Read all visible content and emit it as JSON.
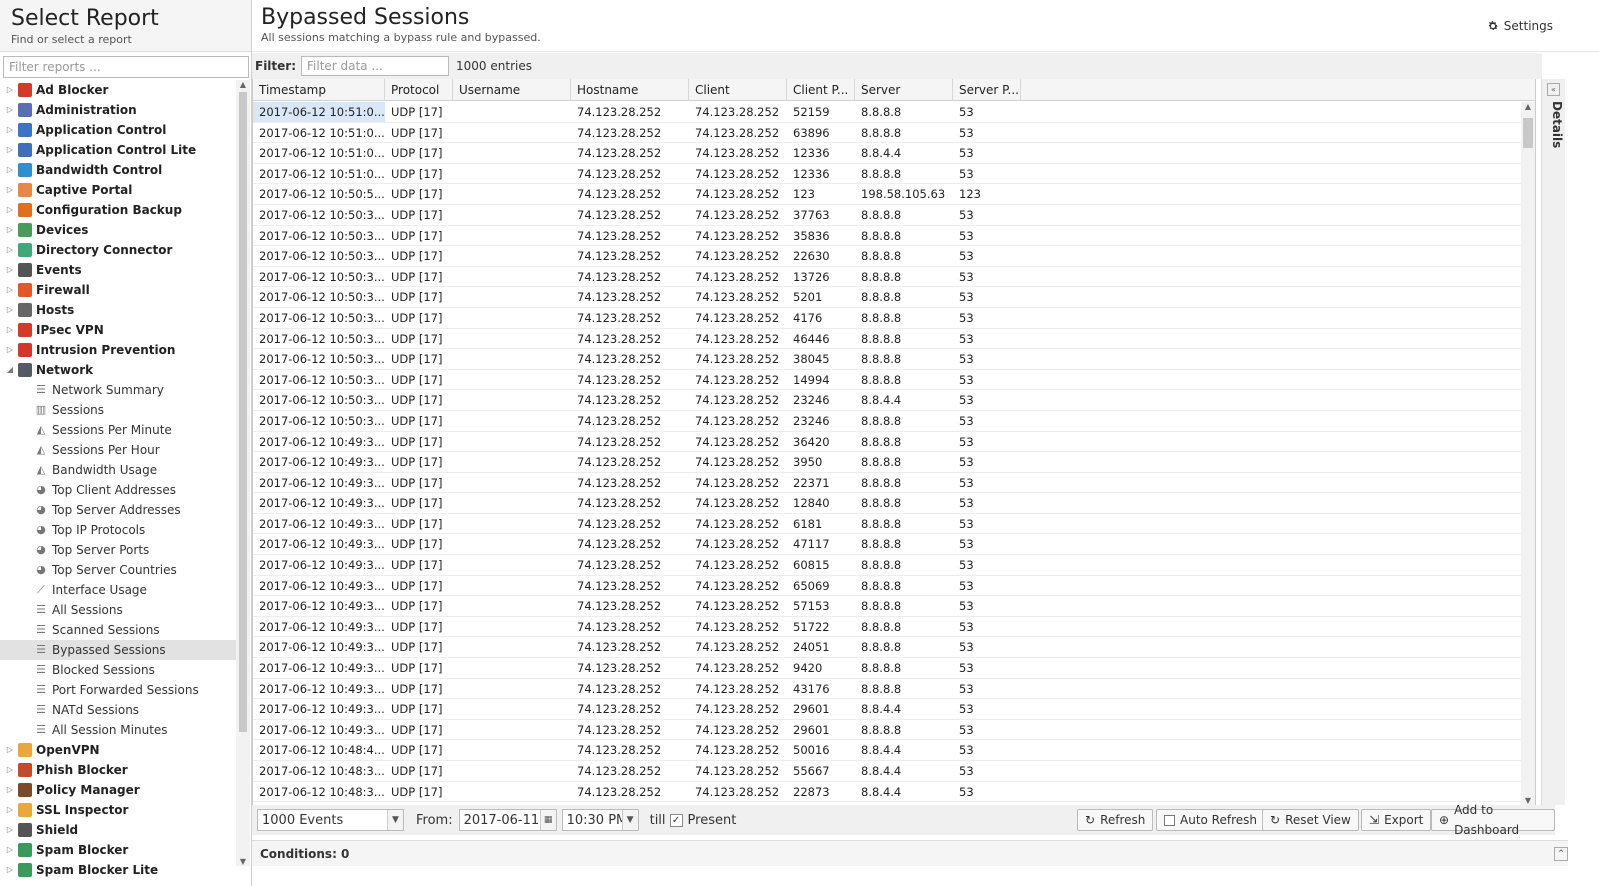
{
  "left_panel": {
    "title": "Select Report",
    "subtitle": "Find or select a report",
    "filter_placeholder": "Filter reports ..."
  },
  "tree": [
    {
      "label": "Ad Blocker",
      "type": "app",
      "icon": "ad-blocker-icon",
      "color": "#d23a2a",
      "expanded": false
    },
    {
      "label": "Administration",
      "type": "app",
      "icon": "administration-icon",
      "color": "#5a6fb3",
      "expanded": false
    },
    {
      "label": "Application Control",
      "type": "app",
      "icon": "application-control-icon",
      "color": "#3b73c6",
      "expanded": false
    },
    {
      "label": "Application Control Lite",
      "type": "app",
      "icon": "application-control-lite-icon",
      "color": "#3f6fb8",
      "expanded": false
    },
    {
      "label": "Bandwidth Control",
      "type": "app",
      "icon": "bandwidth-control-icon",
      "color": "#2f8fcf",
      "expanded": false
    },
    {
      "label": "Captive Portal",
      "type": "app",
      "icon": "captive-portal-icon",
      "color": "#e8874a",
      "expanded": false
    },
    {
      "label": "Configuration Backup",
      "type": "app",
      "icon": "configuration-backup-icon",
      "color": "#e0701f",
      "expanded": false
    },
    {
      "label": "Devices",
      "type": "app",
      "icon": "devices-icon",
      "color": "#4a9a5a",
      "expanded": false
    },
    {
      "label": "Directory Connector",
      "type": "app",
      "icon": "directory-connector-icon",
      "color": "#3eaa7a",
      "expanded": false
    },
    {
      "label": "Events",
      "type": "app",
      "icon": "events-icon",
      "color": "#555",
      "expanded": false
    },
    {
      "label": "Firewall",
      "type": "app",
      "icon": "firewall-icon",
      "color": "#e25a2a",
      "expanded": false
    },
    {
      "label": "Hosts",
      "type": "app",
      "icon": "hosts-icon",
      "color": "#666",
      "expanded": false
    },
    {
      "label": "IPsec VPN",
      "type": "app",
      "icon": "ipsec-vpn-icon",
      "color": "#d23a2a",
      "expanded": false
    },
    {
      "label": "Intrusion Prevention",
      "type": "app",
      "icon": "intrusion-prevention-icon",
      "color": "#d2382a",
      "expanded": false
    },
    {
      "label": "Network",
      "type": "app",
      "icon": "network-icon",
      "color": "#555a66",
      "expanded": true
    },
    {
      "label": "Network Summary",
      "type": "child",
      "icon": "list-icon"
    },
    {
      "label": "Sessions",
      "type": "child",
      "icon": "bar-chart-icon"
    },
    {
      "label": "Sessions Per Minute",
      "type": "child",
      "icon": "area-chart-icon"
    },
    {
      "label": "Sessions Per Hour",
      "type": "child",
      "icon": "area-chart-icon"
    },
    {
      "label": "Bandwidth Usage",
      "type": "child",
      "icon": "area-chart-icon"
    },
    {
      "label": "Top Client Addresses",
      "type": "child",
      "icon": "pie-chart-icon"
    },
    {
      "label": "Top Server Addresses",
      "type": "child",
      "icon": "pie-chart-icon"
    },
    {
      "label": "Top IP Protocols",
      "type": "child",
      "icon": "pie-chart-icon"
    },
    {
      "label": "Top Server Ports",
      "type": "child",
      "icon": "pie-chart-icon"
    },
    {
      "label": "Top Server Countries",
      "type": "child",
      "icon": "pie-chart-icon"
    },
    {
      "label": "Interface Usage",
      "type": "child",
      "icon": "line-chart-icon"
    },
    {
      "label": "All Sessions",
      "type": "child",
      "icon": "list-icon"
    },
    {
      "label": "Scanned Sessions",
      "type": "child",
      "icon": "list-icon"
    },
    {
      "label": "Bypassed Sessions",
      "type": "child",
      "icon": "list-icon",
      "selected": true
    },
    {
      "label": "Blocked Sessions",
      "type": "child",
      "icon": "list-icon"
    },
    {
      "label": "Port Forwarded Sessions",
      "type": "child",
      "icon": "list-icon"
    },
    {
      "label": "NATd Sessions",
      "type": "child",
      "icon": "list-icon"
    },
    {
      "label": "All Session Minutes",
      "type": "child",
      "icon": "list-icon"
    },
    {
      "label": "OpenVPN",
      "type": "app",
      "icon": "openvpn-icon",
      "color": "#e8a93a",
      "expanded": false
    },
    {
      "label": "Phish Blocker",
      "type": "app",
      "icon": "phish-blocker-icon",
      "color": "#c44a2a",
      "expanded": false
    },
    {
      "label": "Policy Manager",
      "type": "app",
      "icon": "policy-manager-icon",
      "color": "#7a4a2a",
      "expanded": false
    },
    {
      "label": "SSL Inspector",
      "type": "app",
      "icon": "ssl-inspector-icon",
      "color": "#e8a93a",
      "expanded": false
    },
    {
      "label": "Shield",
      "type": "app",
      "icon": "shield-icon",
      "color": "#555",
      "expanded": false
    },
    {
      "label": "Spam Blocker",
      "type": "app",
      "icon": "spam-blocker-icon",
      "color": "#3a9a5a",
      "expanded": false
    },
    {
      "label": "Spam Blocker Lite",
      "type": "app",
      "icon": "spam-blocker-lite-icon",
      "color": "#3a9a5a",
      "expanded": false
    }
  ],
  "main": {
    "title": "Bypassed Sessions",
    "subtitle": "All sessions matching a bypass rule and bypassed.",
    "settings_label": "Settings",
    "filter_label": "Filter:",
    "filter_placeholder": "Filter data ...",
    "entries": "1000 entries"
  },
  "grid": {
    "columns": [
      "Timestamp",
      "Protocol",
      "Username",
      "Hostname",
      "Client",
      "Client P...",
      "Server",
      "Server P..."
    ],
    "rows": [
      [
        "2017-06-12 10:51:0...",
        "UDP [17]",
        "",
        "74.123.28.252",
        "74.123.28.252",
        "52159",
        "8.8.8.8",
        "53"
      ],
      [
        "2017-06-12 10:51:0...",
        "UDP [17]",
        "",
        "74.123.28.252",
        "74.123.28.252",
        "63896",
        "8.8.8.8",
        "53"
      ],
      [
        "2017-06-12 10:51:0...",
        "UDP [17]",
        "",
        "74.123.28.252",
        "74.123.28.252",
        "12336",
        "8.8.4.4",
        "53"
      ],
      [
        "2017-06-12 10:51:0...",
        "UDP [17]",
        "",
        "74.123.28.252",
        "74.123.28.252",
        "12336",
        "8.8.8.8",
        "53"
      ],
      [
        "2017-06-12 10:50:5...",
        "UDP [17]",
        "",
        "74.123.28.252",
        "74.123.28.252",
        "123",
        "198.58.105.63",
        "123"
      ],
      [
        "2017-06-12 10:50:3...",
        "UDP [17]",
        "",
        "74.123.28.252",
        "74.123.28.252",
        "37763",
        "8.8.8.8",
        "53"
      ],
      [
        "2017-06-12 10:50:3...",
        "UDP [17]",
        "",
        "74.123.28.252",
        "74.123.28.252",
        "35836",
        "8.8.8.8",
        "53"
      ],
      [
        "2017-06-12 10:50:3...",
        "UDP [17]",
        "",
        "74.123.28.252",
        "74.123.28.252",
        "22630",
        "8.8.8.8",
        "53"
      ],
      [
        "2017-06-12 10:50:3...",
        "UDP [17]",
        "",
        "74.123.28.252",
        "74.123.28.252",
        "13726",
        "8.8.8.8",
        "53"
      ],
      [
        "2017-06-12 10:50:3...",
        "UDP [17]",
        "",
        "74.123.28.252",
        "74.123.28.252",
        "5201",
        "8.8.8.8",
        "53"
      ],
      [
        "2017-06-12 10:50:3...",
        "UDP [17]",
        "",
        "74.123.28.252",
        "74.123.28.252",
        "4176",
        "8.8.8.8",
        "53"
      ],
      [
        "2017-06-12 10:50:3...",
        "UDP [17]",
        "",
        "74.123.28.252",
        "74.123.28.252",
        "46446",
        "8.8.8.8",
        "53"
      ],
      [
        "2017-06-12 10:50:3...",
        "UDP [17]",
        "",
        "74.123.28.252",
        "74.123.28.252",
        "38045",
        "8.8.8.8",
        "53"
      ],
      [
        "2017-06-12 10:50:3...",
        "UDP [17]",
        "",
        "74.123.28.252",
        "74.123.28.252",
        "14994",
        "8.8.8.8",
        "53"
      ],
      [
        "2017-06-12 10:50:3...",
        "UDP [17]",
        "",
        "74.123.28.252",
        "74.123.28.252",
        "23246",
        "8.8.4.4",
        "53"
      ],
      [
        "2017-06-12 10:50:3...",
        "UDP [17]",
        "",
        "74.123.28.252",
        "74.123.28.252",
        "23246",
        "8.8.8.8",
        "53"
      ],
      [
        "2017-06-12 10:49:3...",
        "UDP [17]",
        "",
        "74.123.28.252",
        "74.123.28.252",
        "36420",
        "8.8.8.8",
        "53"
      ],
      [
        "2017-06-12 10:49:3...",
        "UDP [17]",
        "",
        "74.123.28.252",
        "74.123.28.252",
        "3950",
        "8.8.8.8",
        "53"
      ],
      [
        "2017-06-12 10:49:3...",
        "UDP [17]",
        "",
        "74.123.28.252",
        "74.123.28.252",
        "22371",
        "8.8.8.8",
        "53"
      ],
      [
        "2017-06-12 10:49:3...",
        "UDP [17]",
        "",
        "74.123.28.252",
        "74.123.28.252",
        "12840",
        "8.8.8.8",
        "53"
      ],
      [
        "2017-06-12 10:49:3...",
        "UDP [17]",
        "",
        "74.123.28.252",
        "74.123.28.252",
        "6181",
        "8.8.8.8",
        "53"
      ],
      [
        "2017-06-12 10:49:3...",
        "UDP [17]",
        "",
        "74.123.28.252",
        "74.123.28.252",
        "47117",
        "8.8.8.8",
        "53"
      ],
      [
        "2017-06-12 10:49:3...",
        "UDP [17]",
        "",
        "74.123.28.252",
        "74.123.28.252",
        "60815",
        "8.8.8.8",
        "53"
      ],
      [
        "2017-06-12 10:49:3...",
        "UDP [17]",
        "",
        "74.123.28.252",
        "74.123.28.252",
        "65069",
        "8.8.8.8",
        "53"
      ],
      [
        "2017-06-12 10:49:3...",
        "UDP [17]",
        "",
        "74.123.28.252",
        "74.123.28.252",
        "57153",
        "8.8.8.8",
        "53"
      ],
      [
        "2017-06-12 10:49:3...",
        "UDP [17]",
        "",
        "74.123.28.252",
        "74.123.28.252",
        "51722",
        "8.8.8.8",
        "53"
      ],
      [
        "2017-06-12 10:49:3...",
        "UDP [17]",
        "",
        "74.123.28.252",
        "74.123.28.252",
        "24051",
        "8.8.8.8",
        "53"
      ],
      [
        "2017-06-12 10:49:3...",
        "UDP [17]",
        "",
        "74.123.28.252",
        "74.123.28.252",
        "9420",
        "8.8.8.8",
        "53"
      ],
      [
        "2017-06-12 10:49:3...",
        "UDP [17]",
        "",
        "74.123.28.252",
        "74.123.28.252",
        "43176",
        "8.8.8.8",
        "53"
      ],
      [
        "2017-06-12 10:49:3...",
        "UDP [17]",
        "",
        "74.123.28.252",
        "74.123.28.252",
        "29601",
        "8.8.4.4",
        "53"
      ],
      [
        "2017-06-12 10:49:3...",
        "UDP [17]",
        "",
        "74.123.28.252",
        "74.123.28.252",
        "29601",
        "8.8.8.8",
        "53"
      ],
      [
        "2017-06-12 10:48:4...",
        "UDP [17]",
        "",
        "74.123.28.252",
        "74.123.28.252",
        "50016",
        "8.8.4.4",
        "53"
      ],
      [
        "2017-06-12 10:48:3...",
        "UDP [17]",
        "",
        "74.123.28.252",
        "74.123.28.252",
        "55667",
        "8.8.4.4",
        "53"
      ],
      [
        "2017-06-12 10:48:3...",
        "UDP [17]",
        "",
        "74.123.28.252",
        "74.123.28.252",
        "22873",
        "8.8.4.4",
        "53"
      ]
    ]
  },
  "toolbar": {
    "events_value": "1000 Events",
    "from_label": "From:",
    "from_date": "2017-06-11",
    "from_time": "10:30 PM",
    "till_label": "till",
    "present_label": "Present",
    "present_checked": true,
    "refresh_label": "Refresh",
    "auto_refresh_label": "Auto Refresh",
    "reset_view_label": "Reset View",
    "export_label": "Export",
    "add_dashboard_label": "Add to Dashboard"
  },
  "conditions": {
    "label": "Conditions: 0"
  },
  "details": {
    "label": "Details"
  }
}
